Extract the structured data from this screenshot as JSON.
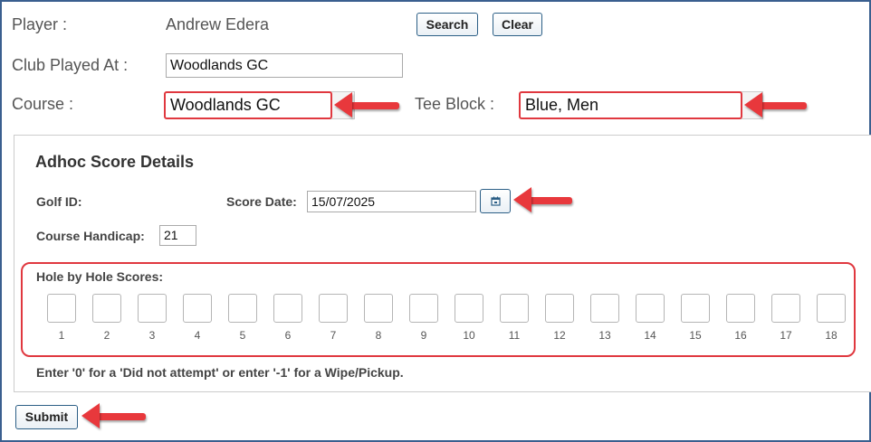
{
  "player": {
    "label": "Player :",
    "name": "Andrew Edera"
  },
  "buttons": {
    "search": "Search",
    "clear": "Clear",
    "submit": "Submit"
  },
  "club": {
    "label": "Club Played At :",
    "value": "Woodlands GC"
  },
  "course": {
    "label": "Course :",
    "value": "Woodlands GC"
  },
  "tee_block": {
    "label": "Tee Block :",
    "value": "Blue, Men"
  },
  "details": {
    "title": "Adhoc Score Details",
    "golf_id_label": "Golf ID:",
    "score_date_label": "Score Date:",
    "score_date_value": "15/07/2025",
    "handicap_label": "Course Handicap:",
    "handicap_value": "21",
    "hole_scores_label": "Hole by Hole Scores:",
    "holes": [
      "1",
      "2",
      "3",
      "4",
      "5",
      "6",
      "7",
      "8",
      "9",
      "10",
      "11",
      "12",
      "13",
      "14",
      "15",
      "16",
      "17",
      "18"
    ],
    "note": "Enter '0' for a 'Did not attempt' or enter '-1' for a Wipe/Pickup."
  },
  "icons": {
    "calendar": "calendar-icon",
    "arrow": "red-arrow-annotation"
  },
  "colors": {
    "highlight": "#e0383f",
    "arrow": "#e8383c",
    "frame": "#3a5f8f"
  }
}
